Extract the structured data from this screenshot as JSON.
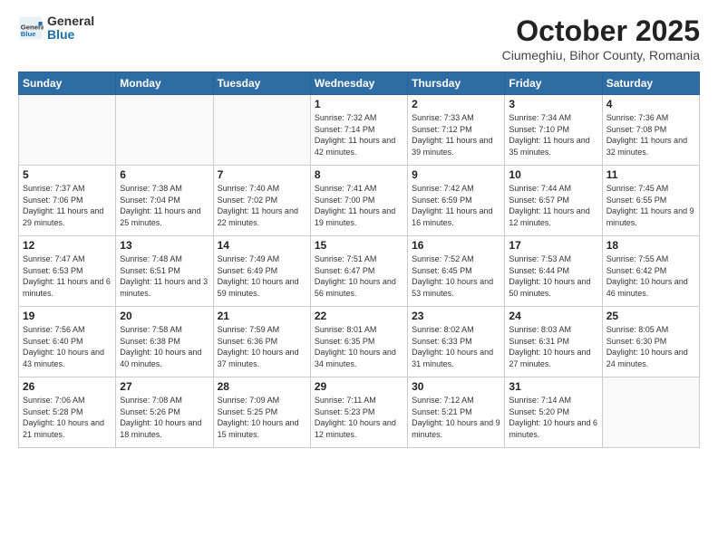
{
  "header": {
    "logo_general": "General",
    "logo_blue": "Blue",
    "month_year": "October 2025",
    "location": "Ciumeghiu, Bihor County, Romania"
  },
  "weekdays": [
    "Sunday",
    "Monday",
    "Tuesday",
    "Wednesday",
    "Thursday",
    "Friday",
    "Saturday"
  ],
  "weeks": [
    [
      {
        "day": "",
        "info": ""
      },
      {
        "day": "",
        "info": ""
      },
      {
        "day": "",
        "info": ""
      },
      {
        "day": "1",
        "info": "Sunrise: 7:32 AM\nSunset: 7:14 PM\nDaylight: 11 hours\nand 42 minutes."
      },
      {
        "day": "2",
        "info": "Sunrise: 7:33 AM\nSunset: 7:12 PM\nDaylight: 11 hours\nand 39 minutes."
      },
      {
        "day": "3",
        "info": "Sunrise: 7:34 AM\nSunset: 7:10 PM\nDaylight: 11 hours\nand 35 minutes."
      },
      {
        "day": "4",
        "info": "Sunrise: 7:36 AM\nSunset: 7:08 PM\nDaylight: 11 hours\nand 32 minutes."
      }
    ],
    [
      {
        "day": "5",
        "info": "Sunrise: 7:37 AM\nSunset: 7:06 PM\nDaylight: 11 hours\nand 29 minutes."
      },
      {
        "day": "6",
        "info": "Sunrise: 7:38 AM\nSunset: 7:04 PM\nDaylight: 11 hours\nand 25 minutes."
      },
      {
        "day": "7",
        "info": "Sunrise: 7:40 AM\nSunset: 7:02 PM\nDaylight: 11 hours\nand 22 minutes."
      },
      {
        "day": "8",
        "info": "Sunrise: 7:41 AM\nSunset: 7:00 PM\nDaylight: 11 hours\nand 19 minutes."
      },
      {
        "day": "9",
        "info": "Sunrise: 7:42 AM\nSunset: 6:59 PM\nDaylight: 11 hours\nand 16 minutes."
      },
      {
        "day": "10",
        "info": "Sunrise: 7:44 AM\nSunset: 6:57 PM\nDaylight: 11 hours\nand 12 minutes."
      },
      {
        "day": "11",
        "info": "Sunrise: 7:45 AM\nSunset: 6:55 PM\nDaylight: 11 hours\nand 9 minutes."
      }
    ],
    [
      {
        "day": "12",
        "info": "Sunrise: 7:47 AM\nSunset: 6:53 PM\nDaylight: 11 hours\nand 6 minutes."
      },
      {
        "day": "13",
        "info": "Sunrise: 7:48 AM\nSunset: 6:51 PM\nDaylight: 11 hours\nand 3 minutes."
      },
      {
        "day": "14",
        "info": "Sunrise: 7:49 AM\nSunset: 6:49 PM\nDaylight: 10 hours\nand 59 minutes."
      },
      {
        "day": "15",
        "info": "Sunrise: 7:51 AM\nSunset: 6:47 PM\nDaylight: 10 hours\nand 56 minutes."
      },
      {
        "day": "16",
        "info": "Sunrise: 7:52 AM\nSunset: 6:45 PM\nDaylight: 10 hours\nand 53 minutes."
      },
      {
        "day": "17",
        "info": "Sunrise: 7:53 AM\nSunset: 6:44 PM\nDaylight: 10 hours\nand 50 minutes."
      },
      {
        "day": "18",
        "info": "Sunrise: 7:55 AM\nSunset: 6:42 PM\nDaylight: 10 hours\nand 46 minutes."
      }
    ],
    [
      {
        "day": "19",
        "info": "Sunrise: 7:56 AM\nSunset: 6:40 PM\nDaylight: 10 hours\nand 43 minutes."
      },
      {
        "day": "20",
        "info": "Sunrise: 7:58 AM\nSunset: 6:38 PM\nDaylight: 10 hours\nand 40 minutes."
      },
      {
        "day": "21",
        "info": "Sunrise: 7:59 AM\nSunset: 6:36 PM\nDaylight: 10 hours\nand 37 minutes."
      },
      {
        "day": "22",
        "info": "Sunrise: 8:01 AM\nSunset: 6:35 PM\nDaylight: 10 hours\nand 34 minutes."
      },
      {
        "day": "23",
        "info": "Sunrise: 8:02 AM\nSunset: 6:33 PM\nDaylight: 10 hours\nand 31 minutes."
      },
      {
        "day": "24",
        "info": "Sunrise: 8:03 AM\nSunset: 6:31 PM\nDaylight: 10 hours\nand 27 minutes."
      },
      {
        "day": "25",
        "info": "Sunrise: 8:05 AM\nSunset: 6:30 PM\nDaylight: 10 hours\nand 24 minutes."
      }
    ],
    [
      {
        "day": "26",
        "info": "Sunrise: 7:06 AM\nSunset: 5:28 PM\nDaylight: 10 hours\nand 21 minutes."
      },
      {
        "day": "27",
        "info": "Sunrise: 7:08 AM\nSunset: 5:26 PM\nDaylight: 10 hours\nand 18 minutes."
      },
      {
        "day": "28",
        "info": "Sunrise: 7:09 AM\nSunset: 5:25 PM\nDaylight: 10 hours\nand 15 minutes."
      },
      {
        "day": "29",
        "info": "Sunrise: 7:11 AM\nSunset: 5:23 PM\nDaylight: 10 hours\nand 12 minutes."
      },
      {
        "day": "30",
        "info": "Sunrise: 7:12 AM\nSunset: 5:21 PM\nDaylight: 10 hours\nand 9 minutes."
      },
      {
        "day": "31",
        "info": "Sunrise: 7:14 AM\nSunset: 5:20 PM\nDaylight: 10 hours\nand 6 minutes."
      },
      {
        "day": "",
        "info": ""
      }
    ]
  ]
}
